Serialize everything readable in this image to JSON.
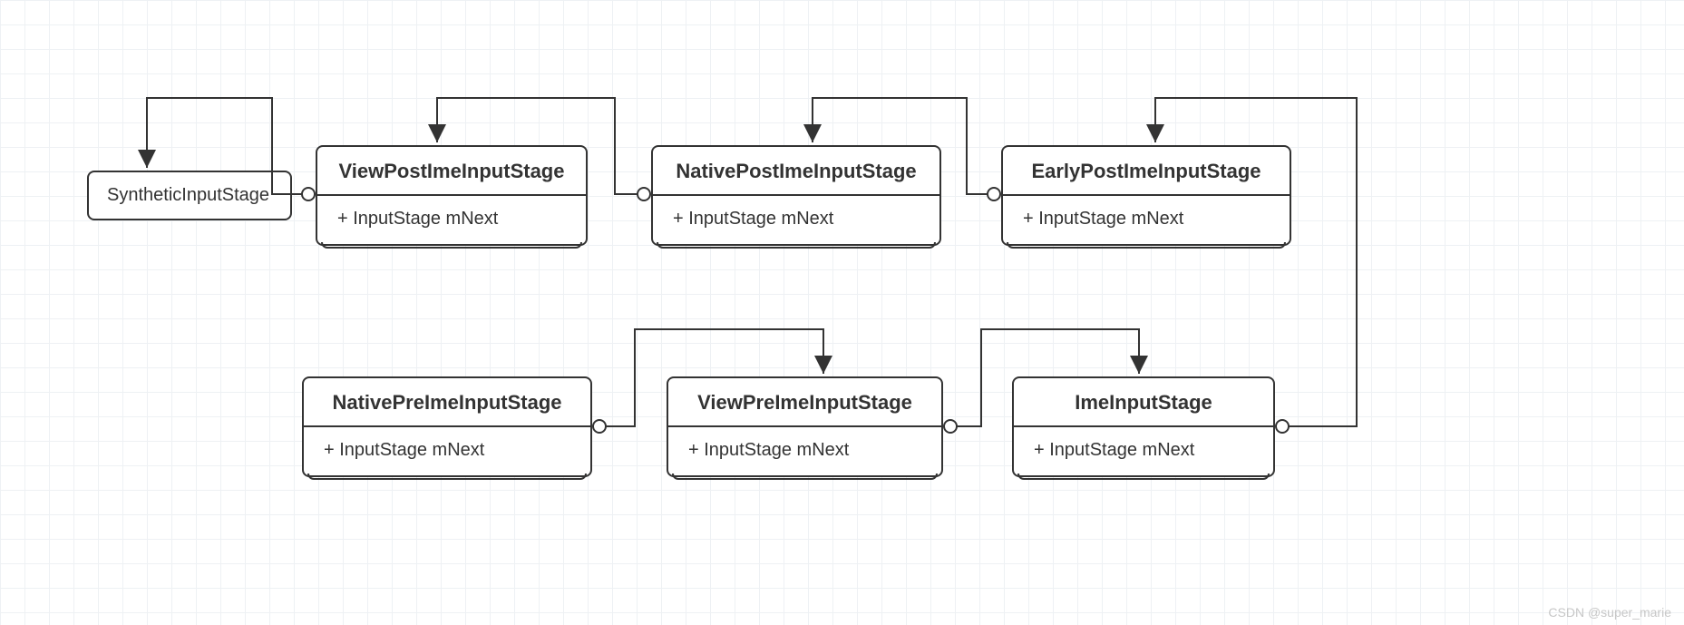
{
  "boxes": {
    "synthetic": "SyntheticInputStage",
    "viewPost": {
      "title": "ViewPostImeInputStage",
      "attr": "+ InputStage mNext"
    },
    "nativePost": {
      "title": "NativePostImeInputStage",
      "attr": "+ InputStage mNext"
    },
    "earlyPost": {
      "title": "EarlyPostImeInputStage",
      "attr": "+ InputStage mNext"
    },
    "nativePre": {
      "title": "NativePreImeInputStage",
      "attr": "+ InputStage mNext"
    },
    "viewPre": {
      "title": "ViewPreImeInputStage",
      "attr": "+ InputStage mNext"
    },
    "ime": {
      "title": "ImeInputStage",
      "attr": "+ InputStage mNext"
    }
  },
  "watermark": "CSDN @super_marie"
}
